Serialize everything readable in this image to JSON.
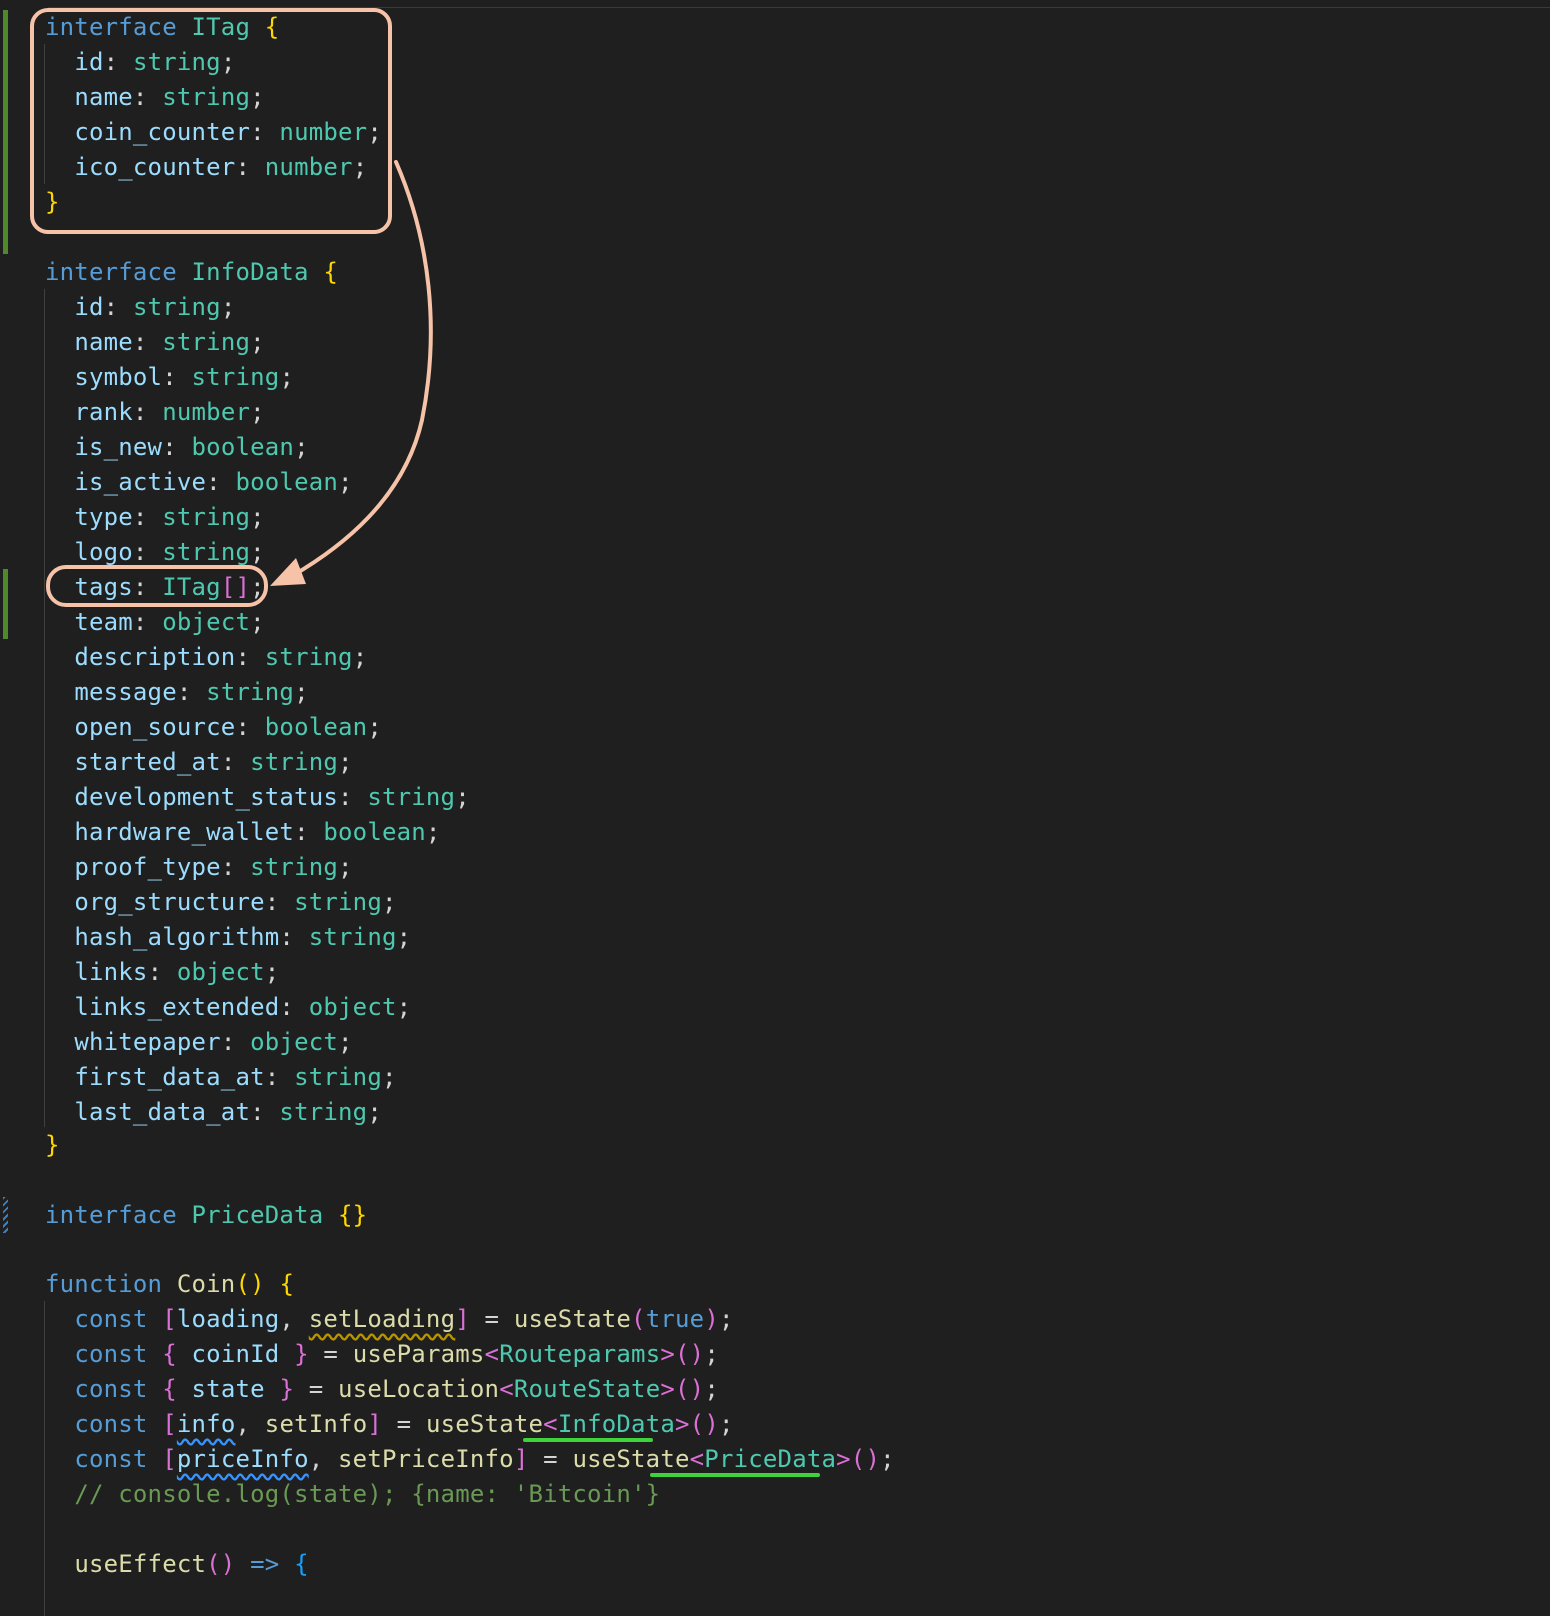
{
  "editor": {
    "itag": {
      "header": [
        "interface",
        " ",
        "ITag",
        " ",
        "{"
      ],
      "fields": [
        {
          "name": "id",
          "type": "string"
        },
        {
          "name": "name",
          "type": "string"
        },
        {
          "name": "coin_counter",
          "type": "number"
        },
        {
          "name": "ico_counter",
          "type": "number"
        }
      ],
      "close": "}"
    },
    "infodata": {
      "keyword": "interface",
      "name": "InfoData",
      "open": "{",
      "fields": [
        {
          "name": "id",
          "type": "string"
        },
        {
          "name": "name",
          "type": "string"
        },
        {
          "name": "symbol",
          "type": "string"
        },
        {
          "name": "rank",
          "type": "number"
        },
        {
          "name": "is_new",
          "type": "boolean"
        },
        {
          "name": "is_active",
          "type": "boolean"
        },
        {
          "name": "type",
          "type": "string"
        },
        {
          "name": "logo",
          "type": "string"
        },
        {
          "name": "tags",
          "type": "ITag",
          "suffix": "[]"
        },
        {
          "name": "team",
          "type": "object"
        },
        {
          "name": "description",
          "type": "string"
        },
        {
          "name": "message",
          "type": "string"
        },
        {
          "name": "open_source",
          "type": "boolean"
        },
        {
          "name": "started_at",
          "type": "string"
        },
        {
          "name": "development_status",
          "type": "string"
        },
        {
          "name": "hardware_wallet",
          "type": "boolean"
        },
        {
          "name": "proof_type",
          "type": "string"
        },
        {
          "name": "org_structure",
          "type": "string"
        },
        {
          "name": "hash_algorithm",
          "type": "string"
        },
        {
          "name": "links",
          "type": "object"
        },
        {
          "name": "links_extended",
          "type": "object"
        },
        {
          "name": "whitepaper",
          "type": "object"
        },
        {
          "name": "first_data_at",
          "type": "string"
        },
        {
          "name": "last_data_at",
          "type": "string"
        }
      ],
      "close": "}"
    },
    "pricedata": {
      "keyword": "interface",
      "name": "PriceData",
      "body": "{}"
    },
    "coin": {
      "keyword": "function",
      "name": "Coin",
      "parens": "()",
      "open": "{",
      "const": "const",
      "loading": "loading",
      "setLoading": "setLoading",
      "useState": "useState",
      "true_value": "true",
      "coinId": "coinId",
      "useParams": "useParams",
      "routeparams": "Routeparams",
      "state": "state",
      "useLocation": "useLocation",
      "routestate": "RouteState",
      "info": "info",
      "setInfo": "setInfo",
      "infodata_type": "InfoData",
      "priceInfo": "priceInfo",
      "setPriceInfo": "setPriceInfo",
      "pricedata_type": "PriceData",
      "comment": "// console.log(state); {name: ",
      "comment_str": "'Bitcoin'",
      "comment_end": "}",
      "useEffect": "useEffect",
      "arrow": "=>"
    },
    "colors": {
      "background": "#1f1f1f",
      "highlight_box": "#f6c3a9",
      "underline": "#3ed33a",
      "git_gutter": "#4e8a2a"
    }
  }
}
